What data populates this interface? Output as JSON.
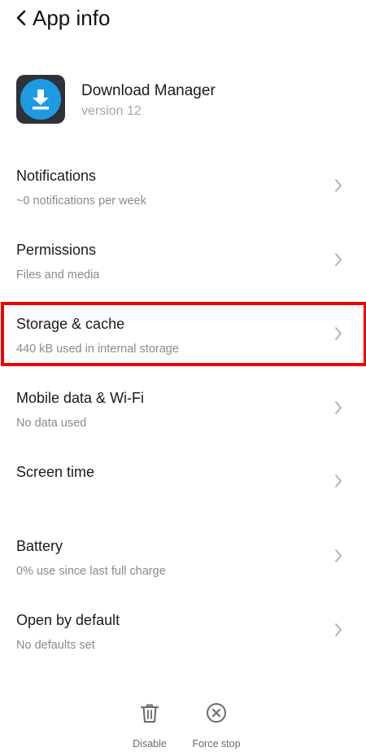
{
  "header": {
    "title": "App info",
    "back_icon": "chevron-left-icon"
  },
  "app": {
    "name": "Download Manager",
    "version": "version 12",
    "icon": "download-app-icon",
    "colors": {
      "icon_bg": "#2f3238",
      "icon_circle": "#1e9be0"
    }
  },
  "settings": {
    "items": [
      {
        "title": "Notifications",
        "subtitle": "~0 notifications per week"
      },
      {
        "title": "Permissions",
        "subtitle": "Files and media"
      },
      {
        "title": "Storage & cache",
        "subtitle": "440 kB used in internal storage",
        "highlighted": true
      },
      {
        "title": "Mobile data & Wi-Fi",
        "subtitle": "No data used"
      },
      {
        "title": "Screen time",
        "subtitle": ""
      },
      {
        "title": "Battery",
        "subtitle": "0% use since last full charge"
      },
      {
        "title": "Open by default",
        "subtitle": "No defaults set"
      }
    ],
    "chevron_icon": "chevron-right-icon"
  },
  "highlight_color": "#ee0000",
  "actions": {
    "disable": {
      "label": "Disable",
      "icon": "trash-icon"
    },
    "force_stop": {
      "label": "Force stop",
      "icon": "close-circle-icon"
    }
  }
}
